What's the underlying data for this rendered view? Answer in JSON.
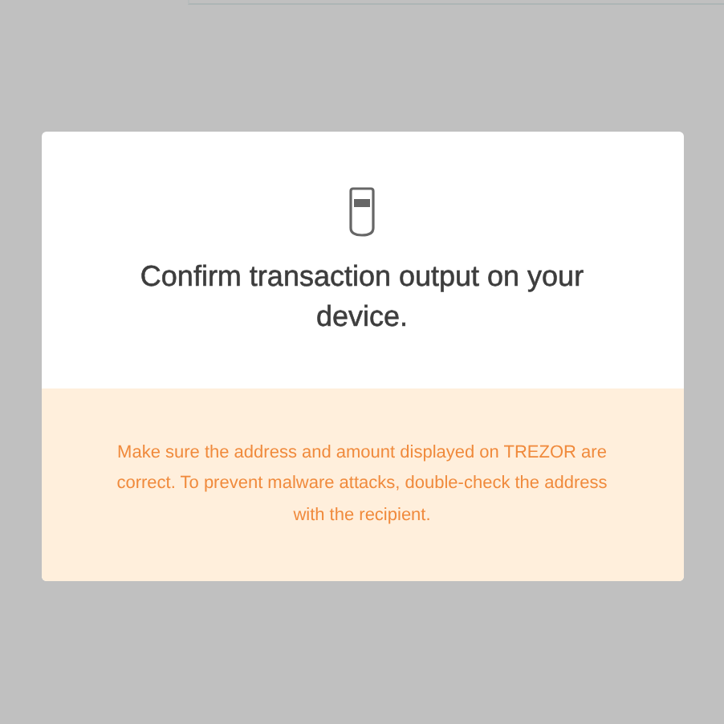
{
  "modal": {
    "title": "Confirm transaction output on your device.",
    "warning": "Make sure the address and amount displayed on TREZOR are correct. To prevent malware attacks, double-check the address with the recipient."
  }
}
